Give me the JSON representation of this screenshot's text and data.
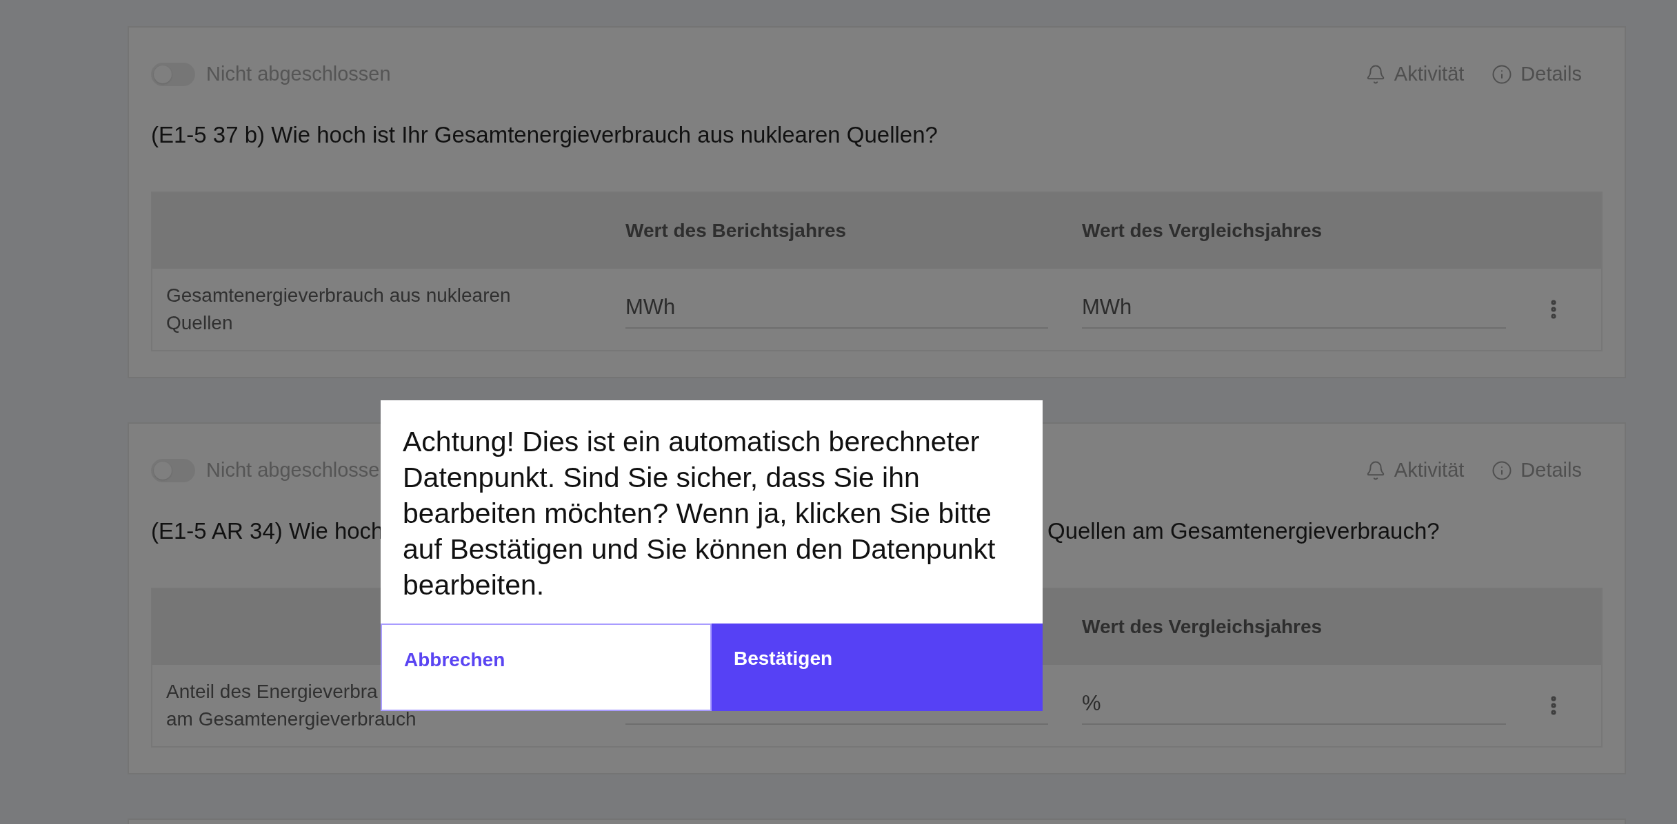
{
  "cards": [
    {
      "status": {
        "label": "Nicht abgeschlossen",
        "on": false
      },
      "actions": [
        {
          "kind": "activity",
          "label": "Aktivität"
        },
        {
          "kind": "details",
          "label": "Details"
        }
      ],
      "question": [
        "(E1-5 37 b) Wie hoch ist Ihr Gesamtenergieverbrauch aus nuklearen Quellen?"
      ],
      "table": {
        "column_2": "Wert des Berichtsjahres",
        "column_3": "Wert des Vergleichsjahres",
        "rows": [
          {
            "label": [
              "Gesamtenergieverbrauch aus nuklearen",
              "Quellen"
            ],
            "reporting": "MWh",
            "comparison": "MWh"
          }
        ]
      }
    },
    {
      "status": {
        "label": "Nicht abgeschlosse",
        "on": false
      },
      "actions": [
        {
          "kind": "activity",
          "label": "Aktivität"
        },
        {
          "kind": "details",
          "label": "Details"
        }
      ],
      "question": [
        "(E1-5 AR 34) Wie hoch",
        "Quellen am Gesamtenergieverbrauch?"
      ],
      "table": {
        "column_3": "Wert des Vergleichsjahres",
        "rows": [
          {
            "label": [
              "Anteil des Energieverbra",
              "am Gesamtenergieverbrauch"
            ],
            "comparison": "%"
          }
        ]
      }
    }
  ],
  "dialog": {
    "message": "Achtung! Dies ist ein automatisch berechneter Datenpunkt. Sind Sie sicher, dass Sie ihn bearbeiten möchten? Wenn ja, klicken Sie bitte auf Bestätigen und Sie können den Datenpunkt bearbeiten.",
    "cancel": "Abbrechen",
    "confirm": "Bestätigen"
  }
}
